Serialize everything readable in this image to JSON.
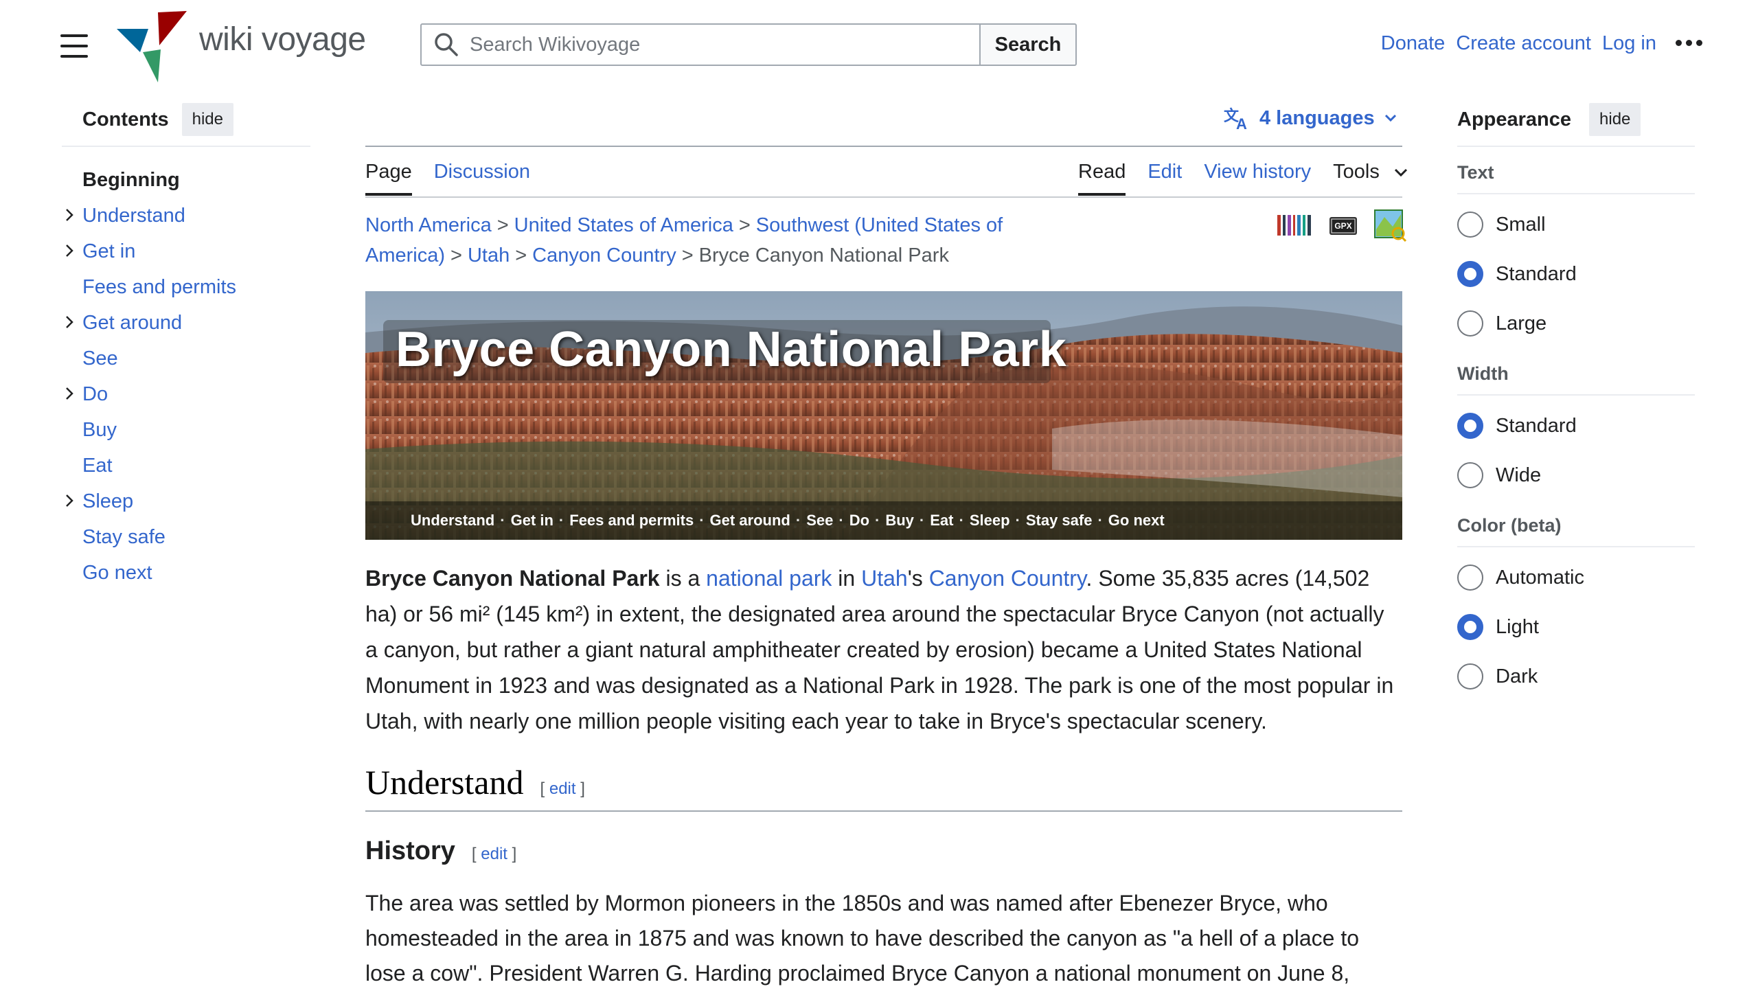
{
  "header": {
    "logo_text": "wiki voyage",
    "search": {
      "placeholder": "Search Wikivoyage",
      "button_label": "Search"
    },
    "user_links": [
      "Donate",
      "Create account",
      "Log in"
    ]
  },
  "toc": {
    "title": "Contents",
    "hide_label": "hide",
    "items": [
      {
        "label": "Beginning",
        "bold": true,
        "expandable": false
      },
      {
        "label": "Understand",
        "expandable": true
      },
      {
        "label": "Get in",
        "expandable": true
      },
      {
        "label": "Fees and permits",
        "expandable": false
      },
      {
        "label": "Get around",
        "expandable": true
      },
      {
        "label": "See",
        "expandable": false
      },
      {
        "label": "Do",
        "expandable": true
      },
      {
        "label": "Buy",
        "expandable": false
      },
      {
        "label": "Eat",
        "expandable": false
      },
      {
        "label": "Sleep",
        "expandable": true
      },
      {
        "label": "Stay safe",
        "expandable": false
      },
      {
        "label": "Go next",
        "expandable": false
      }
    ]
  },
  "languages": {
    "label": "4 languages"
  },
  "tabs": {
    "page": "Page",
    "discussion": "Discussion",
    "read": "Read",
    "edit": "Edit",
    "view_history": "View history",
    "tools": "Tools"
  },
  "breadcrumb": {
    "links": [
      "North America",
      "United States of America",
      "Southwest (United States of America)",
      "Utah",
      "Canyon Country"
    ],
    "current": "Bryce Canyon National Park",
    "separator": ">",
    "gpx_label": "GPX"
  },
  "banner": {
    "title": "Bryce Canyon National Park",
    "nav": [
      "Understand",
      "Get in",
      "Fees and permits",
      "Get around",
      "See",
      "Do",
      "Buy",
      "Eat",
      "Sleep",
      "Stay safe",
      "Go next"
    ],
    "dot": "·"
  },
  "article": {
    "lead": {
      "bold": "Bryce Canyon National Park",
      "t1": " is a ",
      "link1": "national park",
      "t2": " in ",
      "link2": "Utah",
      "t3": "'s ",
      "link3": "Canyon Country",
      "t4": ". Some 35,835 acres (14,502 ha) or 56 mi² (145 km²) in extent, the designated area around the spectacular Bryce Canyon (not actually a canyon, but rather a giant natural amphitheater created by erosion) became a United States National Monument in 1923 and was designated as a National Park in 1928. The park is one of the most popular in Utah, with nearly one million people visiting each year to take in Bryce's spectacular scenery."
    },
    "h2": "Understand",
    "h3": "History",
    "edit_label": "edit",
    "bracket_open": "[",
    "bracket_close": "]",
    "para2": "The area was settled by Mormon pioneers in the 1850s and was named after Ebenezer Bryce, who homesteaded in the area in 1875 and was known to have described the canyon as \"a hell of a place to lose a cow\". President Warren G. Harding proclaimed Bryce Canyon a national monument on June 8,"
  },
  "appearance": {
    "title": "Appearance",
    "hide_label": "hide",
    "sections": [
      {
        "title": "Text",
        "options": [
          {
            "label": "Small",
            "checked": false
          },
          {
            "label": "Standard",
            "checked": true
          },
          {
            "label": "Large",
            "checked": false
          }
        ]
      },
      {
        "title": "Width",
        "options": [
          {
            "label": "Standard",
            "checked": true
          },
          {
            "label": "Wide",
            "checked": false
          }
        ]
      },
      {
        "title": "Color (beta)",
        "options": [
          {
            "label": "Automatic",
            "checked": false
          },
          {
            "label": "Light",
            "checked": true
          },
          {
            "label": "Dark",
            "checked": false
          }
        ]
      }
    ]
  },
  "colors": {
    "link": "#3366cc",
    "text": "#202122",
    "accent": "#3366cc"
  }
}
